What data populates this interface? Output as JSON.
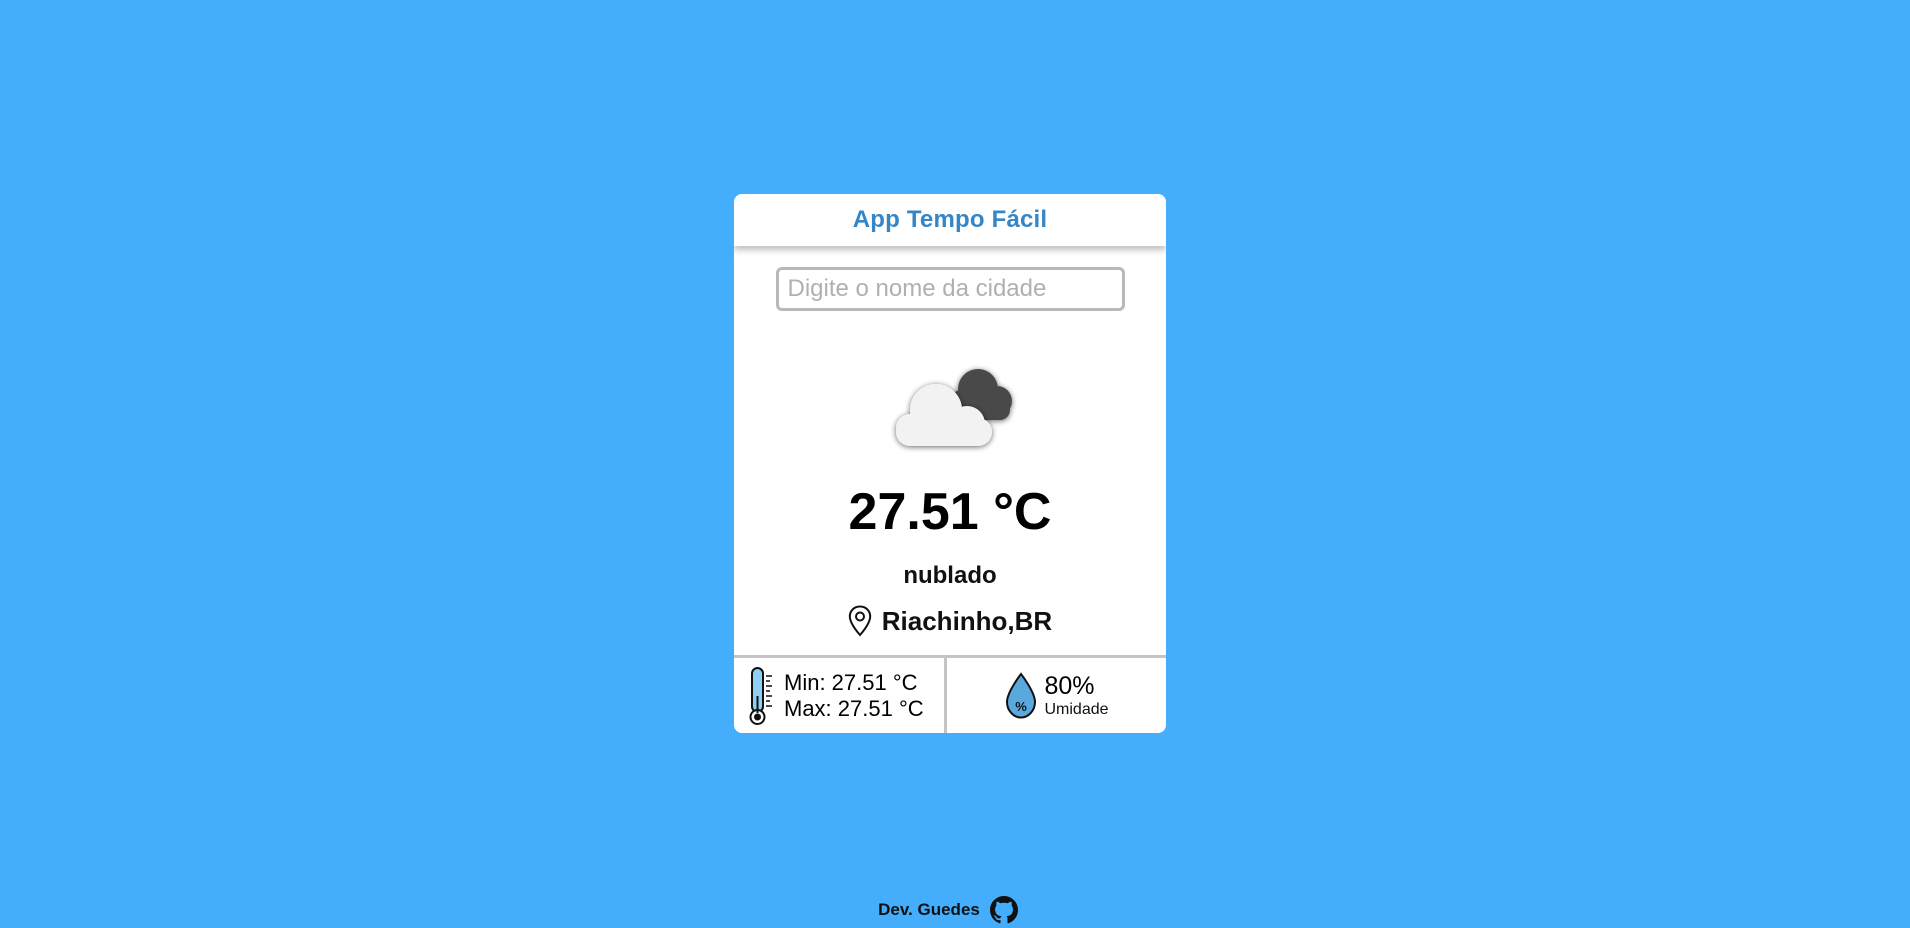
{
  "app": {
    "title": "App Tempo Fácil"
  },
  "search": {
    "placeholder": "Digite o nome da cidade",
    "value": ""
  },
  "weather": {
    "icon": "cloudy-icon",
    "temperature": "27.51 °C",
    "description": "nublado",
    "location": "Riachinho,BR"
  },
  "details": {
    "min": "Min: 27.51 °C",
    "max": "Max: 27.51 °C",
    "humidity_value": "80%",
    "humidity_label": "Umidade"
  },
  "credit": {
    "text": "Dev. Guedes",
    "icon": "github-icon"
  },
  "colors": {
    "background": "#45aefc",
    "title": "#3486c7",
    "card": "#ffffff"
  }
}
